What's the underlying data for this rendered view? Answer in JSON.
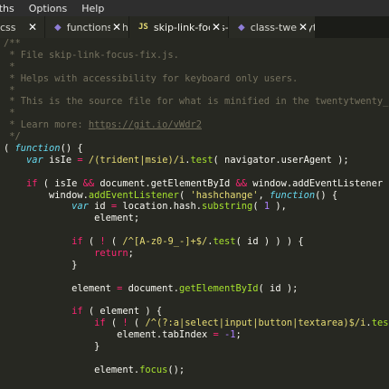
{
  "menubar": {
    "items": [
      "aths",
      "Options",
      "Help"
    ]
  },
  "tabs": [
    {
      "label": "css",
      "icon": "css-file-icon",
      "active": false
    },
    {
      "label": "functions.php",
      "icon": "php-file-icon",
      "active": false
    },
    {
      "label": "skip-link-focus-fix",
      "icon": "js-file-icon",
      "active": true
    },
    {
      "label": "class-twentyt",
      "icon": "php-file-icon",
      "active": false
    }
  ],
  "tab_close_glyph": "✕",
  "js_icon_text": "JS",
  "code": {
    "lines": [
      "/**",
      " * File skip-link-focus-fix.js.",
      " *",
      " * Helps with accessibility for keyboard only users.",
      " *",
      " * This is the source file for what is minified in the twentytwenty_skip_link() PHP function.",
      " *",
      " * Learn more: https://git.io/vWdr2",
      " */",
      "( function() {",
      "    var isIe = /(trident|msie)/i.test( navigator.userAgent );",
      "",
      "    if ( isIe && document.getElementById && window.addEventListener ) {",
      "        window.addEventListener( 'hashchange', function() {",
      "            var id = location.hash.substring( 1 ),",
      "                element;",
      "",
      "            if ( ! ( /^[A-z0-9_-]+$/.test( id ) ) ) {",
      "                return;",
      "            }",
      "",
      "            element = document.getElementById( id );",
      "",
      "            if ( element ) {",
      "                if ( ! ( /^(?:a|select|input|button|textarea)$/i.test( element.tagName ) ) ) {",
      "                    element.tabIndex = -1;",
      "                }",
      "",
      "                element.focus();"
    ]
  },
  "colors": {
    "background": "#272822",
    "comment": "#75715e",
    "keyword_storage": "#66d9ef",
    "keyword": "#f92672",
    "string": "#e6db74",
    "number": "#ae81ff",
    "function": "#a6e22e",
    "text": "#f8f8f2"
  }
}
